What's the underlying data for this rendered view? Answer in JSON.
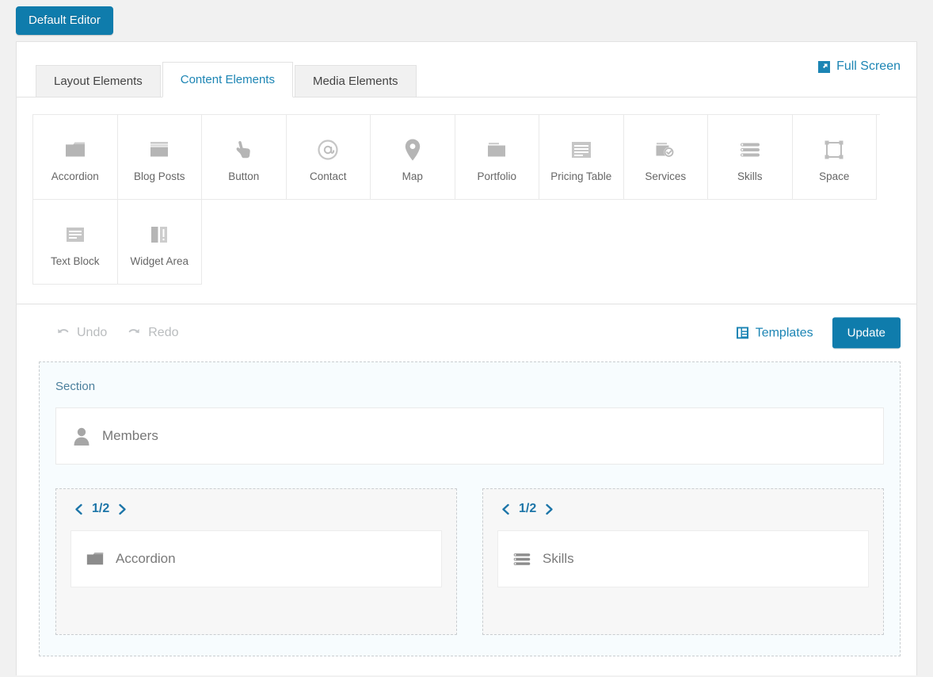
{
  "top_bar": {
    "editor_switch_label": "Default Editor"
  },
  "tabs": [
    {
      "label": "Layout Elements",
      "active": false
    },
    {
      "label": "Content Elements",
      "active": true
    },
    {
      "label": "Media Elements",
      "active": false
    }
  ],
  "fullscreen": {
    "label": "Full Screen",
    "icon": "fullscreen-icon"
  },
  "elements": [
    {
      "label": "Accordion",
      "icon": "accordion-icon"
    },
    {
      "label": "Blog Posts",
      "icon": "blog-posts-icon"
    },
    {
      "label": "Button",
      "icon": "pointing-hand-icon"
    },
    {
      "label": "Contact",
      "icon": "at-sign-icon"
    },
    {
      "label": "Map",
      "icon": "map-pin-icon"
    },
    {
      "label": "Portfolio",
      "icon": "portfolio-folder-icon"
    },
    {
      "label": "Pricing Table",
      "icon": "pricing-table-icon"
    },
    {
      "label": "Services",
      "icon": "services-check-icon"
    },
    {
      "label": "Skills",
      "icon": "skills-list-icon"
    },
    {
      "label": "Space",
      "icon": "space-frame-icon"
    },
    {
      "label": "Text Block",
      "icon": "text-block-icon"
    },
    {
      "label": "Widget Area",
      "icon": "widget-area-icon"
    }
  ],
  "action_bar": {
    "undo_label": "Undo",
    "undo_icon": "undo-arrow-icon",
    "redo_label": "Redo",
    "redo_icon": "redo-arrow-icon",
    "templates_label": "Templates",
    "templates_icon": "templates-layout-icon",
    "update_label": "Update"
  },
  "canvas": {
    "section_label": "Section",
    "members_widget": {
      "label": "Members",
      "icon": "person-icon"
    },
    "columns": [
      {
        "nav_label": "1/2",
        "prev_icon": "chevron-left-icon",
        "next_icon": "chevron-right-icon",
        "widget": {
          "label": "Accordion",
          "icon": "accordion-icon"
        }
      },
      {
        "nav_label": "1/2",
        "prev_icon": "chevron-left-icon",
        "next_icon": "chevron-right-icon",
        "widget": {
          "label": "Skills",
          "icon": "skills-list-icon"
        }
      }
    ]
  },
  "colors": {
    "accent_blue": "#0f7cac",
    "link_blue": "#1c85b4",
    "icon_gray": "#b5b5b5",
    "section_bg": "#f7fcfe"
  }
}
